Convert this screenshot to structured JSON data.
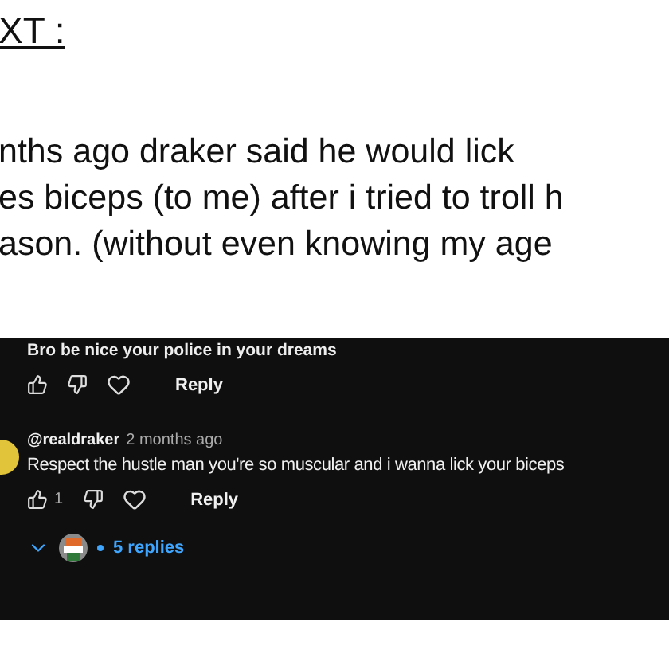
{
  "heading": "XT :",
  "lines": [
    "nths ago draker said he would lick",
    "es biceps (to me) after i tried to troll h",
    "ason. (without even knowing my age"
  ],
  "comments": [
    {
      "text": "Bro be nice your police in your dreams",
      "reply": "Reply"
    },
    {
      "author": "@realdraker",
      "time": "2 months ago",
      "text": "Respect the hustle man you're so muscular and i wanna lick your biceps",
      "likes": "1",
      "reply": "Reply",
      "replies": "5 replies"
    }
  ]
}
